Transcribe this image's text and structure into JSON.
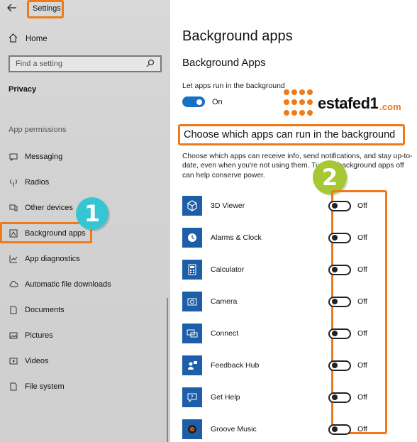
{
  "window": {
    "title": "Settings",
    "back_icon": "back-arrow-icon"
  },
  "sidebar": {
    "home_label": "Home",
    "search_placeholder": "Find a setting",
    "section_title": "Privacy",
    "group_label": "App permissions",
    "items": [
      {
        "label": "Messaging",
        "icon": "message-icon"
      },
      {
        "label": "Radios",
        "icon": "radio-icon"
      },
      {
        "label": "Other devices",
        "icon": "device-icon"
      },
      {
        "label": "Background apps",
        "icon": "background-apps-icon"
      },
      {
        "label": "App diagnostics",
        "icon": "diagnostics-icon"
      },
      {
        "label": "Automatic file downloads",
        "icon": "cloud-icon"
      },
      {
        "label": "Documents",
        "icon": "document-icon"
      },
      {
        "label": "Pictures",
        "icon": "picture-icon"
      },
      {
        "label": "Videos",
        "icon": "video-icon"
      },
      {
        "label": "File system",
        "icon": "file-icon"
      }
    ]
  },
  "annotations": {
    "badge1": "1",
    "badge2": "2",
    "highlight_color": "#f07a1a",
    "badge1_color": "#36c6d3",
    "badge2_color": "#a6c832"
  },
  "watermark": {
    "brand": "estafed1",
    "domain": ".com"
  },
  "main": {
    "page_title": "Background apps",
    "section_title": "Background Apps",
    "master_label": "Let apps run in the background",
    "master_state": "On",
    "choose_heading": "Choose which apps can run in the background",
    "description": "Choose which apps can receive info, send notifications, and stay up-to-date, even when you're not using them. Turning background apps off can help conserve power.",
    "apps": [
      {
        "name": "3D Viewer",
        "state": "Off",
        "icon": "3d-viewer-icon"
      },
      {
        "name": "Alarms & Clock",
        "state": "Off",
        "icon": "clock-icon"
      },
      {
        "name": "Calculator",
        "state": "Off",
        "icon": "calculator-icon"
      },
      {
        "name": "Camera",
        "state": "Off",
        "icon": "camera-icon"
      },
      {
        "name": "Connect",
        "state": "Off",
        "icon": "connect-icon"
      },
      {
        "name": "Feedback Hub",
        "state": "Off",
        "icon": "feedback-icon"
      },
      {
        "name": "Get Help",
        "state": "Off",
        "icon": "help-icon"
      },
      {
        "name": "Groove Music",
        "state": "Off",
        "icon": "music-icon"
      }
    ]
  }
}
